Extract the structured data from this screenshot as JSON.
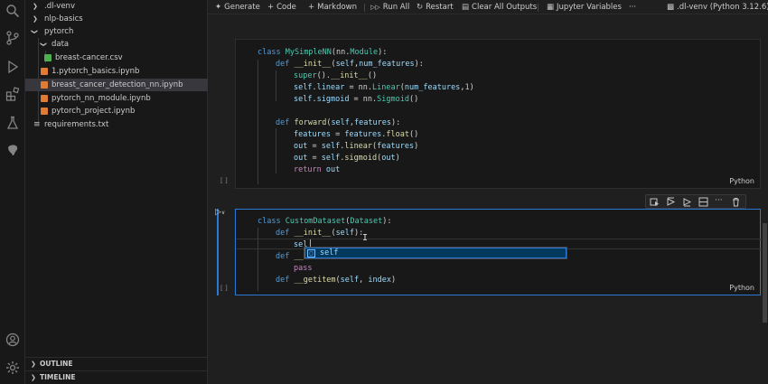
{
  "explorer": {
    "items": [
      {
        "label": ".dl-venv",
        "type": "folder",
        "expanded": false
      },
      {
        "label": "nlp-basics",
        "type": "folder",
        "expanded": false
      },
      {
        "label": "pytorch",
        "type": "folder",
        "expanded": true
      },
      {
        "label": "data",
        "type": "folder",
        "expanded": true
      },
      {
        "label": "breast-cancer.csv",
        "type": "csv"
      },
      {
        "label": "1.pytorch_basics.ipynb",
        "type": "notebook"
      },
      {
        "label": "breast_cancer_detection_nn.ipynb",
        "type": "notebook",
        "selected": true
      },
      {
        "label": "pytorch_nn_module.ipynb",
        "type": "notebook"
      },
      {
        "label": "pytorch_project.ipynb",
        "type": "notebook"
      },
      {
        "label": "requirements.txt",
        "type": "text"
      }
    ],
    "outline_label": "OUTLINE",
    "timeline_label": "TIMELINE"
  },
  "toolbar": {
    "generate": "Generate",
    "code": "Code",
    "markdown": "Markdown",
    "run_all": "Run All",
    "restart": "Restart",
    "clear_outputs": "Clear All Outputs",
    "jupyter_variables": "Jupyter Variables",
    "more": "···",
    "kernel": ".dl-venv (Python 3.12.6)"
  },
  "cell1": {
    "lines": [
      "class MySimpleNN(nn.Module):",
      "def __init__(self,num_features):",
      "super().__init__()",
      "self.linear = nn.Linear(num_features,1)",
      "self.sigmoid = nn.Sigmoid()",
      "def forward(self,features):",
      "features = features.float()",
      "out = self.linear(features)",
      "out = self.sigmoid(out)",
      "return out"
    ],
    "language": "Python",
    "marker": "[ ]"
  },
  "cell2": {
    "lines": [
      "class CustomDataset(Dataset):",
      "def __init__(self):",
      "sel",
      "def __l",
      "pass",
      "def __getitem(self, index)"
    ],
    "language": "Python",
    "marker": "[ ]",
    "suggestion": "self"
  },
  "colors": {
    "accent": "#2b79d6",
    "keyword": "#569cd6",
    "class": "#4ec9b0",
    "function": "#dcdcaa",
    "variable": "#9cdcfe"
  }
}
